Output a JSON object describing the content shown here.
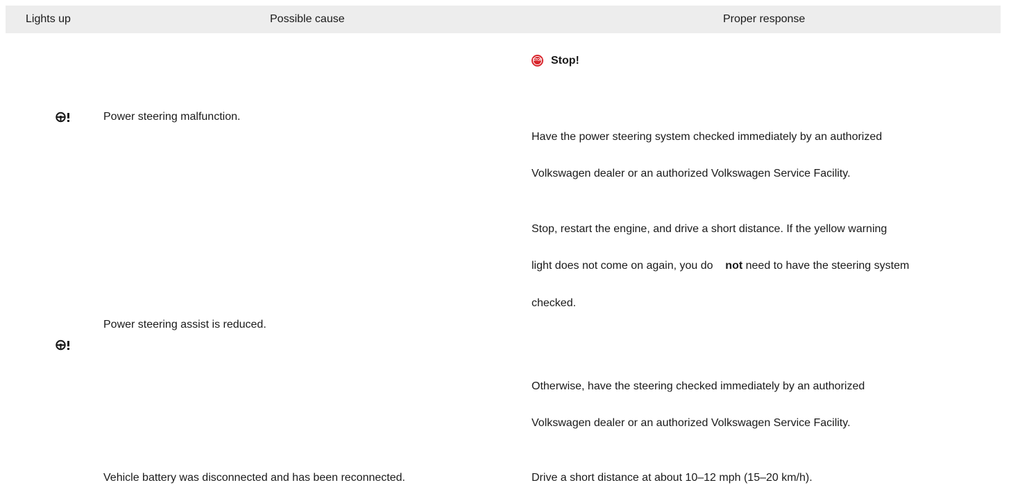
{
  "table": {
    "headers": {
      "lights_up": "Lights up",
      "possible_cause": "Possible cause",
      "proper_response": "Proper response"
    },
    "stop_badge_text": "STOP",
    "stop_label": "Stop!",
    "rows": [
      {
        "indicator_icon": "power-steering-warning-icon",
        "cause": "Power steering malfunction.",
        "response_lines": [
          "Have the power steering system checked immediately by an authorized",
          "Volkswagen dealer or an authorized Volkswagen Service Facility."
        ]
      },
      {
        "indicator_icon": "power-steering-warning-icon",
        "cause": "Power steering assist is reduced.",
        "response_line_1": "Stop, restart the engine, and drive a short distance. If the yellow warning",
        "response_line_2_before": "light does not come on again, you do",
        "response_line_2_bold": "not",
        "response_line_2_after": "need to have the steering system",
        "response_line_3": "checked.",
        "response_lines_otherwise": [
          "Otherwise, have the steering checked immediately by an authorized",
          "Volkswagen dealer or an authorized Volkswagen Service Facility."
        ]
      },
      {
        "cause": "Vehicle battery was disconnected and has been reconnected.",
        "response": "Drive a short distance at about 10–12 mph (15–20 km/h)."
      }
    ]
  },
  "colors": {
    "header_bg": "#ededed",
    "stop_red": "#d8232a",
    "text": "#1a1a1a"
  }
}
